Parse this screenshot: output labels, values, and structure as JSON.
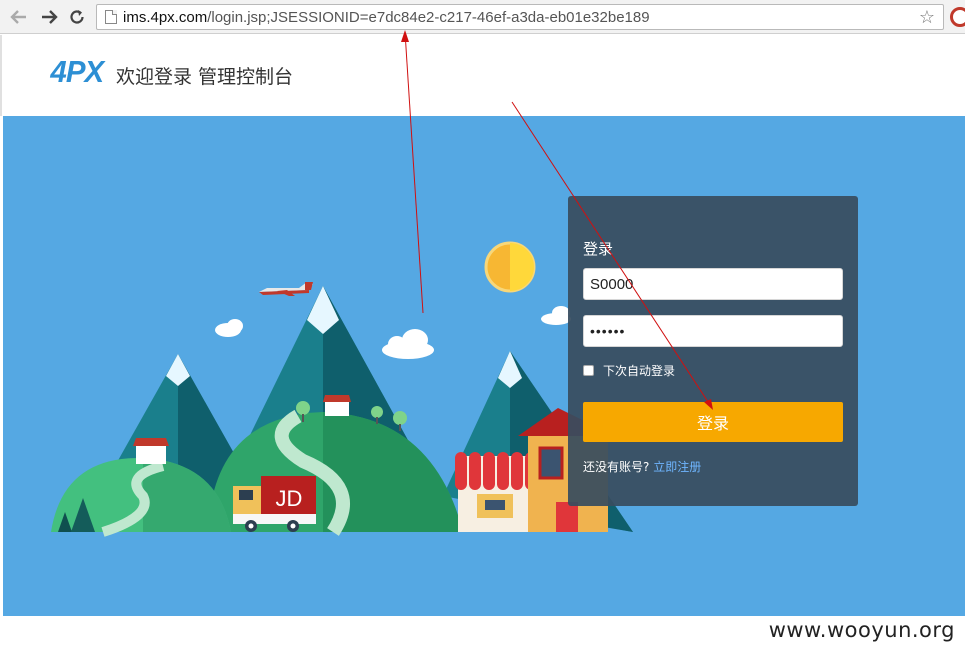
{
  "browser": {
    "url_host": "ims.4px.com",
    "url_path": "/login.jsp;JSESSIONID=e7dc84e2-c217-46ef-a3da-eb01e32be189",
    "icons": [
      "back-arrow-icon",
      "forward-arrow-icon",
      "reload-icon",
      "page-icon",
      "star-icon",
      "extension-icon"
    ]
  },
  "header": {
    "logo": "4PX",
    "title": "欢迎登录 管理控制台"
  },
  "banner": {
    "truck_label": "JD",
    "colors": {
      "sky": "#55a8e3",
      "accent": "#f7a800"
    }
  },
  "login": {
    "heading": "登录",
    "username_value": "S0000",
    "password_value": "••••••",
    "remember_label": "下次自动登录",
    "submit_label": "登录",
    "register_prompt": "还没有账号?",
    "register_link": "立即注册"
  },
  "footer": {
    "watermark": "www.wooyun.org"
  }
}
